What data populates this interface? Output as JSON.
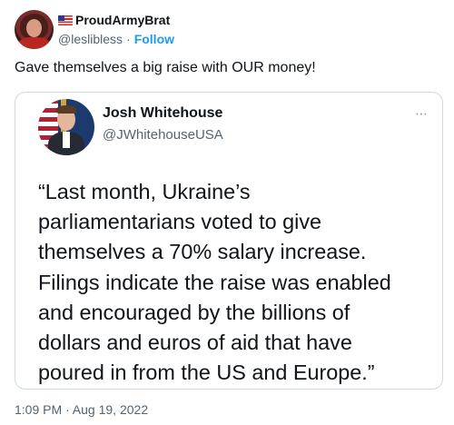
{
  "author": {
    "display_name": "ProudArmyBrat",
    "handle": "@leslibless",
    "separator": "·",
    "follow_label": "Follow",
    "flag_icon": "us-flag-icon"
  },
  "tweet": {
    "text": "Gave themselves a big raise with OUR money!",
    "timestamp": "1:09 PM · Aug 19, 2022"
  },
  "quoted": {
    "display_name": "Josh Whitehouse",
    "handle": "@JWhitehouseUSA",
    "more_icon": "⋯",
    "quote_lines": [
      "“Last month, Ukraine’s",
      "parliamentarians voted to give",
      "themselves a 70% salary increase.",
      "Filings indicate the raise was enabled",
      "and encouraged by the billions of",
      "dollars and euros of aid that have",
      "poured in from the US and Europe.”"
    ]
  },
  "colors": {
    "text": "#0f1419",
    "muted": "#536471",
    "accent": "#1d9bf0",
    "border": "#cfd9de"
  }
}
